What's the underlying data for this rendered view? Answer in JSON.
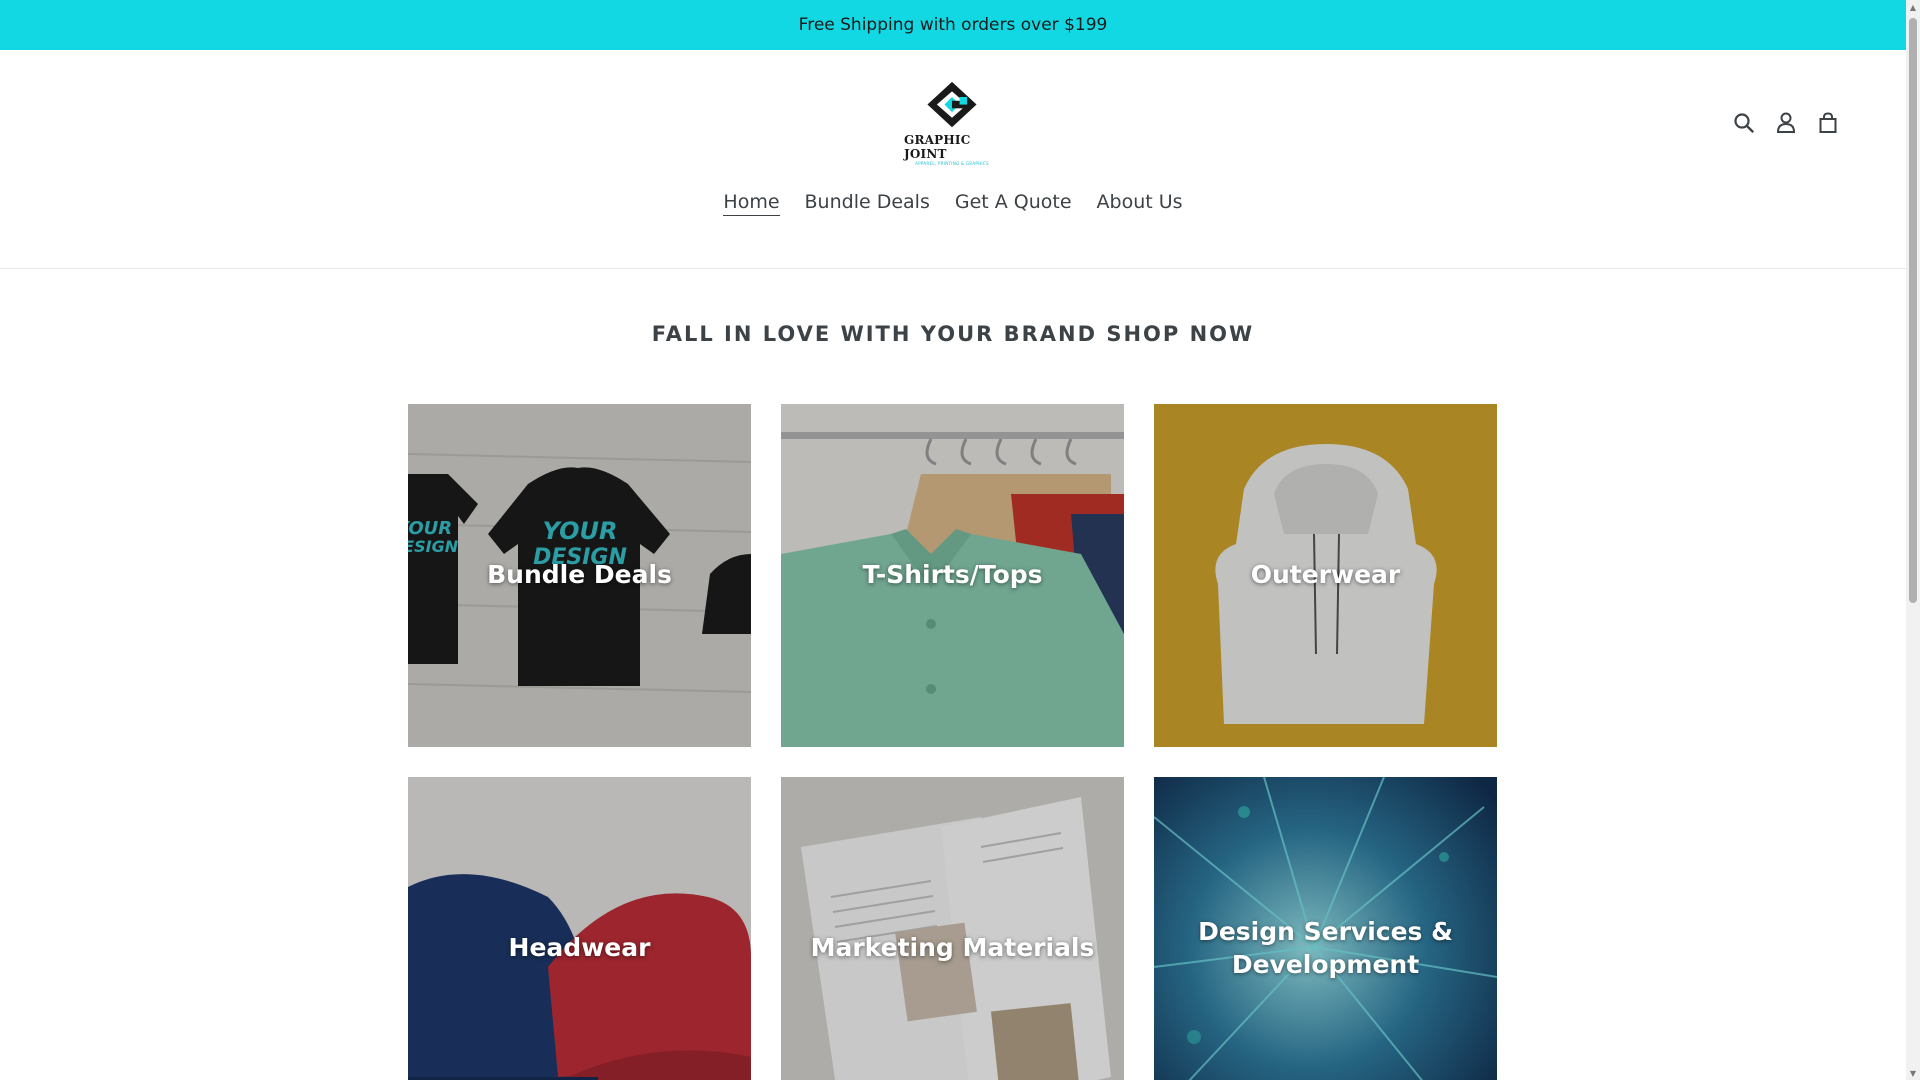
{
  "announcement": {
    "text": "Free Shipping with orders over $199"
  },
  "logo": {
    "name": "GRAPHIC JOINT",
    "tagline": "APPAREL, PRINTING & GRAPHICS",
    "accent_color": "#12d8e3"
  },
  "header_icons": [
    {
      "name": "search-icon",
      "label": "Search"
    },
    {
      "name": "account-icon",
      "label": "Log in"
    },
    {
      "name": "cart-icon",
      "label": "Cart"
    }
  ],
  "nav": {
    "items": [
      {
        "label": "Home",
        "active": true
      },
      {
        "label": "Bundle Deals",
        "active": false
      },
      {
        "label": "Get A Quote",
        "active": false
      },
      {
        "label": "About Us",
        "active": false
      }
    ]
  },
  "main": {
    "heading": "FALL IN LOVE WITH YOUR BRAND SHOP NOW",
    "collections": [
      {
        "title": "Bundle Deals"
      },
      {
        "title": "T-Shirts/Tops"
      },
      {
        "title": "Outerwear"
      },
      {
        "title": "Headwear"
      },
      {
        "title": "Marketing Materials"
      },
      {
        "title": "Design Services & Development"
      }
    ]
  }
}
